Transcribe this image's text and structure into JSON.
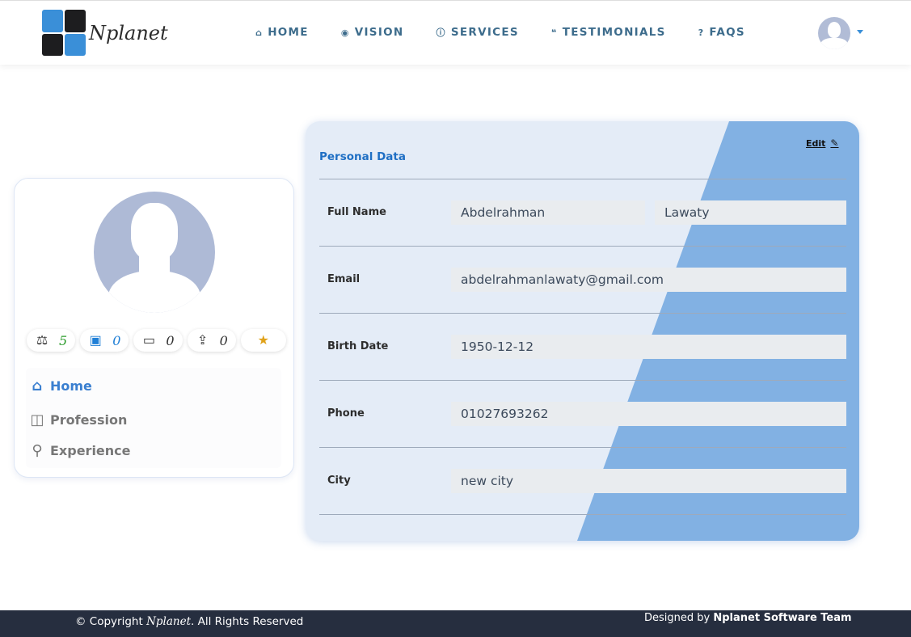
{
  "brand": {
    "name": "Nplanet"
  },
  "nav": {
    "links": [
      {
        "label": "HOME",
        "icon": "home-icon"
      },
      {
        "label": "VISION",
        "icon": "eye-icon"
      },
      {
        "label": "SERVICES",
        "icon": "info-icon"
      },
      {
        "label": "TESTIMONIALS",
        "icon": "quote-icon"
      },
      {
        "label": "FAQS",
        "icon": "question-icon"
      }
    ],
    "accent": "#3d6c8c"
  },
  "profile": {
    "stats": [
      {
        "icon": "money-bag-icon",
        "value": "5",
        "color": "#2c9c2c"
      },
      {
        "icon": "user-card-icon",
        "value": "0",
        "color": "#1f7fd6"
      },
      {
        "icon": "monitor-icon",
        "value": "0",
        "color": "#111111"
      },
      {
        "icon": "upload-icon",
        "value": "0",
        "color": "#111111"
      },
      {
        "icon": "star-icon",
        "value": "",
        "color": "#e0a21a"
      }
    ],
    "menu": [
      {
        "label": "Home",
        "icon": "house-icon",
        "active": true
      },
      {
        "label": "Profession",
        "icon": "briefcase-icon",
        "active": false
      },
      {
        "label": "Experience",
        "icon": "award-icon",
        "active": false
      }
    ]
  },
  "personal": {
    "title": "Personal Data",
    "edit_label": "Edit",
    "rows": {
      "full_name": {
        "label": "Full Name",
        "first": "Abdelrahman",
        "last": "Lawaty"
      },
      "email": {
        "label": "Email",
        "value": "abdelrahmanlawaty@gmail.com"
      },
      "birth_date": {
        "label": "Birth Date",
        "value": "1950-12-12"
      },
      "phone": {
        "label": "Phone",
        "value": "01027693262"
      },
      "city": {
        "label": "City",
        "value": "new city"
      }
    },
    "colors": {
      "card_bg": "#e4ecf7",
      "diagonal": "#82b1e3",
      "title": "#1f6fc4"
    }
  },
  "footer": {
    "copyright_prefix": "© Copyright",
    "copyright_brand": "Nplanet",
    "copyright_suffix": ". All Rights Reserved",
    "designed_prefix": "Designed by",
    "designed_team": "Nplanet Software Team"
  }
}
